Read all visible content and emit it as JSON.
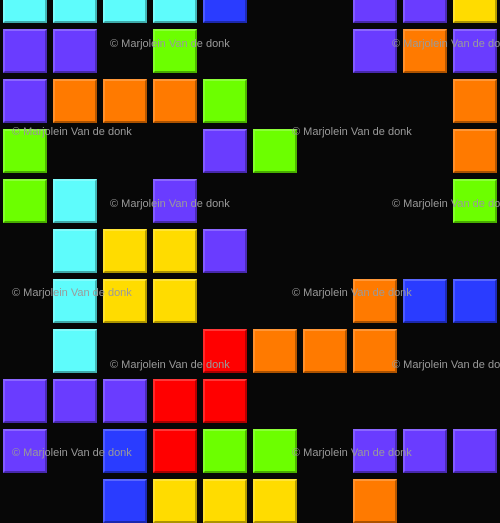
{
  "watermark": "© Marjolein Van de donk",
  "colors": {
    "background": "#070707",
    "cyan": "#5efcfc",
    "blue": "#2a3cff",
    "purple": "#6a3cff",
    "green": "#6cff00",
    "orange": "#ff7a00",
    "yellow": "#ffdc00",
    "red": "#ff0000"
  },
  "tiles": [
    [
      "cyan",
      0,
      0
    ],
    [
      "cyan",
      0,
      1
    ],
    [
      "cyan",
      0,
      2
    ],
    [
      "cyan",
      0,
      3
    ],
    [
      "blue",
      0,
      4
    ],
    [
      "purple",
      0,
      7
    ],
    [
      "purple",
      0,
      8
    ],
    [
      "yellow",
      0,
      9
    ],
    [
      "purple",
      1,
      0
    ],
    [
      "purple",
      1,
      1
    ],
    [
      "green",
      1,
      3
    ],
    [
      "purple",
      1,
      7
    ],
    [
      "orange",
      1,
      8
    ],
    [
      "purple",
      1,
      9
    ],
    [
      "purple",
      2,
      0
    ],
    [
      "orange",
      2,
      1
    ],
    [
      "orange",
      2,
      2
    ],
    [
      "orange",
      2,
      3
    ],
    [
      "green",
      2,
      4
    ],
    [
      "orange",
      2,
      9
    ],
    [
      "green",
      3,
      0
    ],
    [
      "purple",
      3,
      4
    ],
    [
      "green",
      3,
      5
    ],
    [
      "orange",
      3,
      9
    ],
    [
      "green",
      4,
      0
    ],
    [
      "cyan",
      4,
      1
    ],
    [
      "purple",
      4,
      3
    ],
    [
      "green",
      4,
      9
    ],
    [
      "cyan",
      5,
      1
    ],
    [
      "yellow",
      5,
      2
    ],
    [
      "yellow",
      5,
      3
    ],
    [
      "purple",
      5,
      4
    ],
    [
      "cyan",
      6,
      1
    ],
    [
      "yellow",
      6,
      2
    ],
    [
      "yellow",
      6,
      3
    ],
    [
      "orange",
      6,
      7
    ],
    [
      "blue",
      6,
      8
    ],
    [
      "blue",
      6,
      9
    ],
    [
      "cyan",
      7,
      1
    ],
    [
      "red",
      7,
      4
    ],
    [
      "orange",
      7,
      5
    ],
    [
      "orange",
      7,
      6
    ],
    [
      "orange",
      7,
      7
    ],
    [
      "purple",
      8,
      0
    ],
    [
      "purple",
      8,
      1
    ],
    [
      "purple",
      8,
      2
    ],
    [
      "red",
      8,
      3
    ],
    [
      "red",
      8,
      4
    ],
    [
      "purple",
      9,
      0
    ],
    [
      "blue",
      9,
      2
    ],
    [
      "red",
      9,
      3
    ],
    [
      "green",
      9,
      4
    ],
    [
      "green",
      9,
      5
    ],
    [
      "purple",
      9,
      7
    ],
    [
      "purple",
      9,
      8
    ],
    [
      "purple",
      9,
      9
    ],
    [
      "blue",
      10,
      2
    ],
    [
      "yellow",
      10,
      3
    ],
    [
      "yellow",
      10,
      4
    ],
    [
      "yellow",
      10,
      5
    ],
    [
      "orange",
      10,
      7
    ]
  ]
}
